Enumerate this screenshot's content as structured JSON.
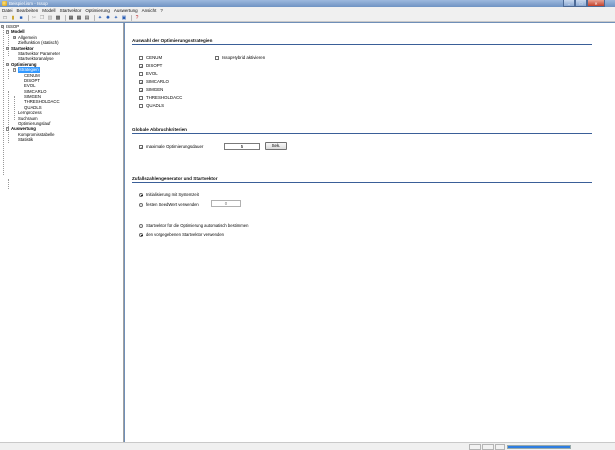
{
  "window": {
    "title": "Beispiel.ism - Issop"
  },
  "menu": [
    "Datei",
    "Bearbeiten",
    "Modell",
    "Startvektor",
    "Optimierung",
    "Auswertung",
    "Ansicht",
    "?"
  ],
  "tree": {
    "root": "ISSOP",
    "modell": "Modell",
    "allgemein": "Allgemein",
    "zielfunktion": "Zielfunktion (statisch)",
    "startvektor": "Startvektor",
    "startvektor_parameter": "Startvektor Parameter",
    "startvektoranalyse": "Startvektoranalyse",
    "optimierung": "Optimierung",
    "strategien": "Strategien",
    "cenum": "CENUM",
    "dissopt": "DISOPT",
    "evol": "EVOL",
    "simcarlo": "SIMCARLO",
    "simgen": "SIMGEN",
    "thresholdacc": "THRESHOLDACC",
    "quadls": "QUADLS",
    "lernprozess": "Lernprozess",
    "suchraum": "Suchraum",
    "optimierungslauf": "Optimierungslauf",
    "auswertung": "Auswertung",
    "kompromisstabelle": "Kompromisstabelle",
    "statistik": "Statistik"
  },
  "strategies_section": {
    "title": "Auswahl der Optimierungsstrategien",
    "hybrid_label": "IssopHybrid aktivieren",
    "items": [
      {
        "label": "CENUM",
        "checked": false
      },
      {
        "label": "DISOPT",
        "checked": true
      },
      {
        "label": "EVOL",
        "checked": false
      },
      {
        "label": "SIMCARLO",
        "checked": true
      },
      {
        "label": "SIMGEN",
        "checked": true
      },
      {
        "label": "THRESHOLDACC",
        "checked": false
      },
      {
        "label": "QUADLS",
        "checked": false
      }
    ]
  },
  "abort_section": {
    "title": "Globale Abbruchkriterien",
    "max_duration_label": "maximale Optimierungsdauer",
    "max_duration_value": "5",
    "unit_button": "Sek."
  },
  "random_section": {
    "title": "Zufallszahlengenerator und Startvektor",
    "init_system_time": "Initialisierung mit Systemzeit",
    "fixed_seed": "festen SeedWert verwenden",
    "seed_value": "0",
    "auto_start": "Startvektor für die Optimierung automatisch bestimmen",
    "given_start": "den vorgegebenen Startvektor verwenden"
  },
  "status": {
    "progress": 1.0
  },
  "colors": {
    "accent": "#3a5f98",
    "selection": "#3399ff",
    "progress": "#2f7de0"
  }
}
